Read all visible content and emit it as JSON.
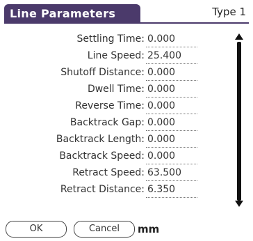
{
  "dialog": {
    "title": "Line Parameters",
    "type_value": "Type 1"
  },
  "rows": [
    {
      "label": "Settling Time:",
      "value": "0.000"
    },
    {
      "label": "Line Speed:",
      "value": "25.400"
    },
    {
      "label": "Shutoff Distance:",
      "value": "0.000"
    },
    {
      "label": "Dwell Time:",
      "value": "0.000"
    },
    {
      "label": "Reverse Time:",
      "value": "0.000"
    },
    {
      "label": "Backtrack Gap:",
      "value": "0.000"
    },
    {
      "label": "Backtrack Length:",
      "value": "0.000"
    },
    {
      "label": "Backtrack Speed:",
      "value": "0.000"
    },
    {
      "label": "Retract Speed:",
      "value": "63.500"
    },
    {
      "label": "Retract Distance:",
      "value": "6.350"
    }
  ],
  "buttons": {
    "ok": "OK",
    "cancel": "Cancel"
  },
  "unit": "mm",
  "colors": {
    "title_bar": "#4b3a6b",
    "title_text": "#ffffff"
  }
}
